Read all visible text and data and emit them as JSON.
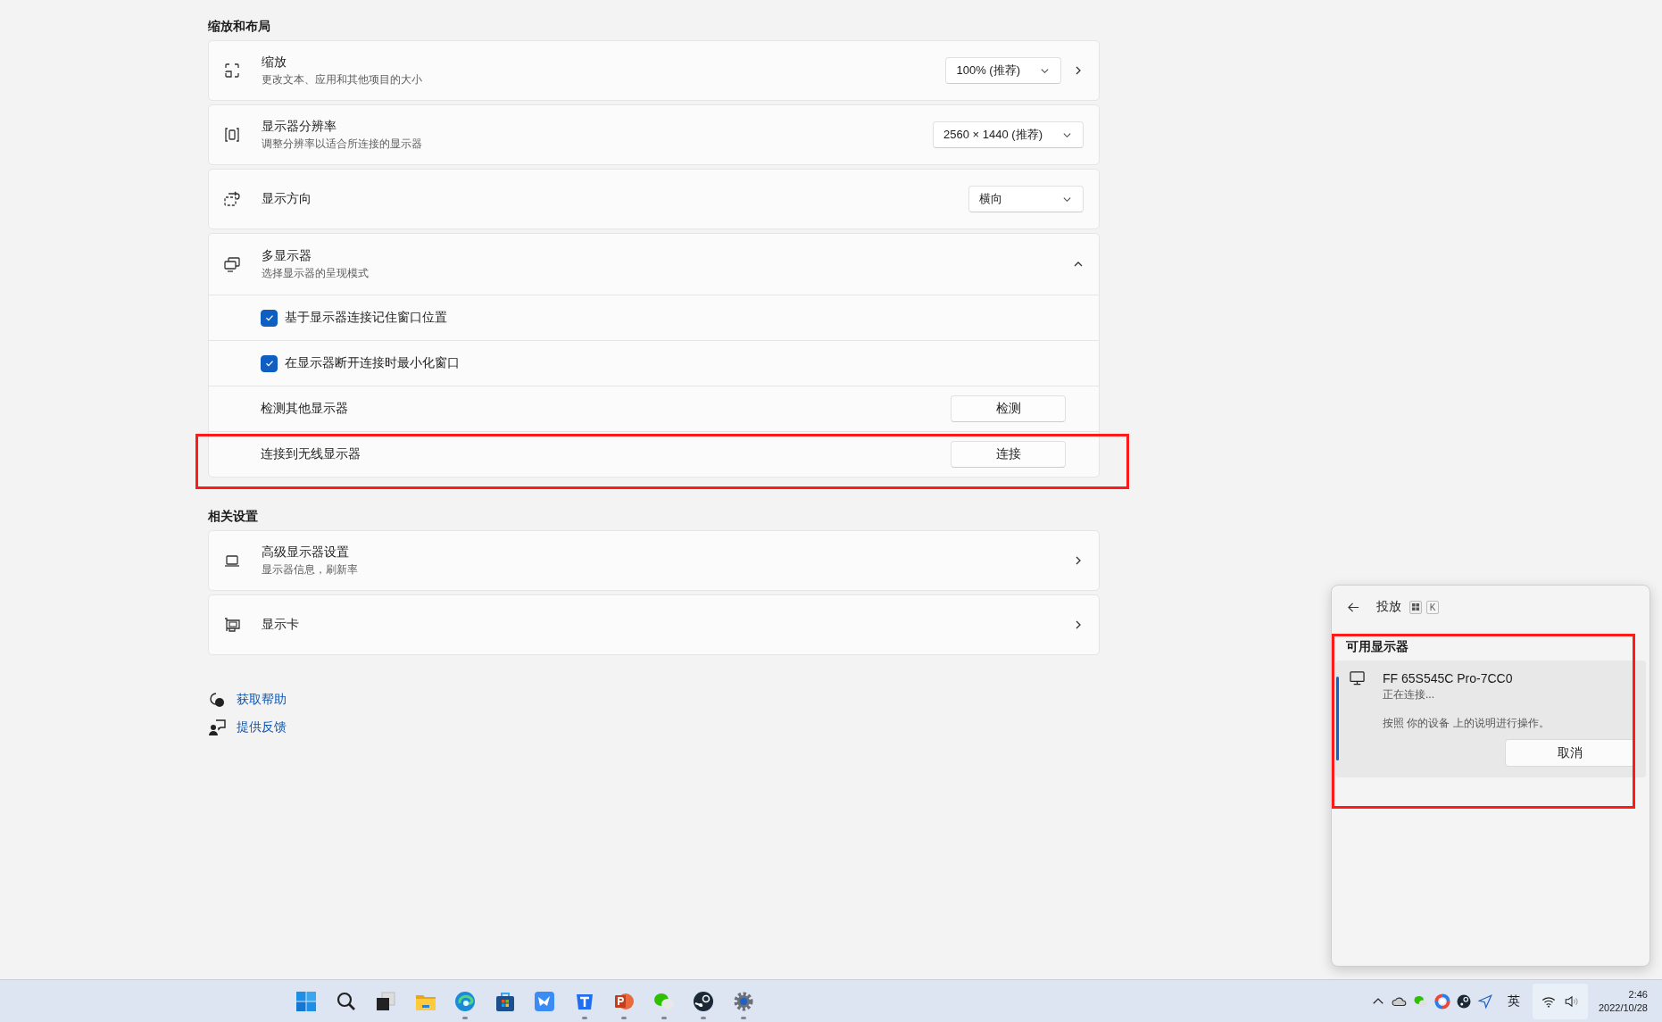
{
  "scale_layout": {
    "heading": "缩放和布局",
    "cards": [
      {
        "kind": "dropdown",
        "title": "缩放",
        "subtitle": "更改文本、应用和其他项目的大小",
        "value": "100% (推荐)",
        "chevron": true
      },
      {
        "kind": "dropdown",
        "title": "显示器分辨率",
        "subtitle": "调整分辨率以适合所连接的显示器",
        "value": "2560 × 1440 (推荐)"
      },
      {
        "kind": "dropdown",
        "title": "显示方向",
        "value": "横向"
      },
      {
        "kind": "expander",
        "title": "多显示器",
        "subtitle": "选择显示器的呈现模式",
        "expanded": true,
        "rows": [
          {
            "kind": "checkbox",
            "label": "基于显示器连接记住窗口位置",
            "checked": true
          },
          {
            "kind": "checkbox",
            "label": "在显示器断开连接时最小化窗口",
            "checked": true
          },
          {
            "kind": "button",
            "label": "检测其他显示器",
            "button": "检测",
            "highlighted": false
          },
          {
            "kind": "button",
            "label": "连接到无线显示器",
            "button": "连接",
            "highlighted": true
          }
        ]
      }
    ]
  },
  "related": {
    "heading": "相关设置",
    "cards": [
      {
        "kind": "link",
        "title": "高级显示器设置",
        "subtitle": "显示器信息，刷新率"
      },
      {
        "kind": "link",
        "title": "显示卡"
      }
    ]
  },
  "help_links": [
    {
      "label": "获取帮助"
    },
    {
      "label": "提供反馈"
    }
  ],
  "cast_panel": {
    "title": "投放",
    "shortcut_key": "K",
    "section": "可用显示器",
    "section_highlighted": true,
    "devices": [
      {
        "name": "FF 65S545C Pro-7CC0",
        "status": "正在连接...",
        "instruction": "按照 你的设备 上的说明进行操作。",
        "button": "取消",
        "selected": true
      }
    ]
  },
  "taskbar": {
    "apps": [
      {
        "running": false
      },
      {
        "running": false
      },
      {
        "running": false
      },
      {
        "running": false
      },
      {
        "running": true
      },
      {
        "running": false
      },
      {
        "running": false
      },
      {
        "running": true
      },
      {
        "running": true
      },
      {
        "running": true
      },
      {
        "running": true
      },
      {
        "running": true
      }
    ],
    "ime": "英",
    "time": "2:46",
    "date": "2022/10/28"
  }
}
